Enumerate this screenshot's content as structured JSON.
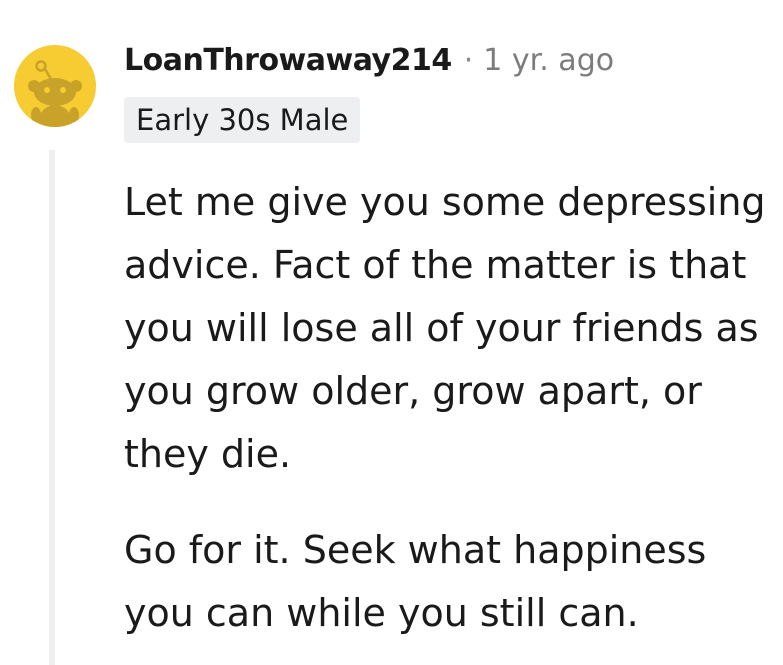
{
  "comment": {
    "author": "LoanThrowaway214",
    "separator": "·",
    "timestamp": "1 yr. ago",
    "flair": "Early 30s Male",
    "paragraphs": [
      "Let me give you some depressing advice. Fact of the matter is that you will lose all of your friends as you grow older, grow apart, or they die.",
      "Go for it. Seek what happiness you can while you still can."
    ]
  },
  "colors": {
    "avatar_bg": "#f6cc32",
    "avatar_snoo": "#c9a22a",
    "thread_line": "#edeff1",
    "flair_bg": "#edeff1",
    "text": "#1a1a1b",
    "meta": "#7c7c7c"
  },
  "icons": {
    "avatar": "snoo-avatar-icon"
  }
}
